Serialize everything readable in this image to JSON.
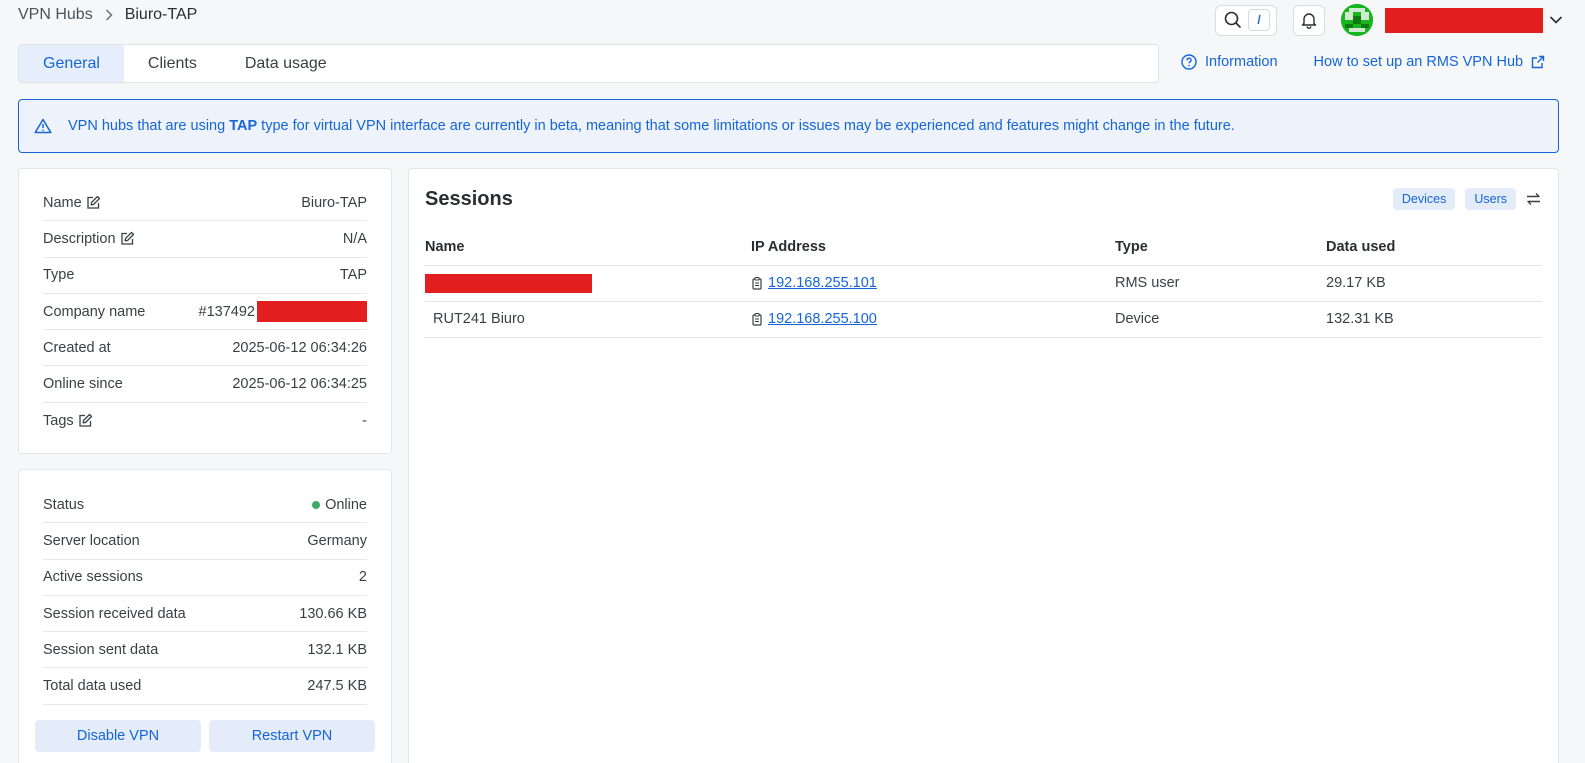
{
  "breadcrumb": {
    "parent": "VPN Hubs",
    "current": "Biuro-TAP"
  },
  "topbar": {
    "search_shortcut": "/"
  },
  "tabs": [
    {
      "label": "General",
      "active": true
    },
    {
      "label": "Clients",
      "active": false
    },
    {
      "label": "Data usage",
      "active": false
    }
  ],
  "links": {
    "information": "Information",
    "howto": "How to set up an RMS VPN Hub"
  },
  "alert": {
    "pre": "VPN hubs that are using ",
    "bold": "TAP",
    "post": " type for virtual VPN interface are currently in beta, meaning that some limitations or issues may be experienced and features might change in the future."
  },
  "info": {
    "name_label": "Name",
    "name_value": "Biuro-TAP",
    "description_label": "Description",
    "description_value": "N/A",
    "type_label": "Type",
    "type_value": "TAP",
    "company_label": "Company name",
    "company_value": "#137492",
    "created_label": "Created at",
    "created_value": "2025-06-12 06:34:26",
    "online_since_label": "Online since",
    "online_since_value": "2025-06-12 06:34:25",
    "tags_label": "Tags",
    "tags_value": "-"
  },
  "status": {
    "status_label": "Status",
    "status_value": "Online",
    "location_label": "Server location",
    "location_value": "Germany",
    "active_label": "Active sessions",
    "active_value": "2",
    "received_label": "Session received data",
    "received_value": "130.66 KB",
    "sent_label": "Session sent data",
    "sent_value": "132.1 KB",
    "total_label": "Total data used",
    "total_value": "247.5 KB",
    "disable_button": "Disable VPN",
    "restart_button": "Restart VPN"
  },
  "sessions": {
    "title": "Sessions",
    "filter_devices": "Devices",
    "filter_users": "Users",
    "columns": [
      "Name",
      "IP Address",
      "Type",
      "Data used"
    ],
    "rows": [
      {
        "name": "",
        "ip": "192.168.255.101",
        "type": "RMS user",
        "data": "29.17 KB"
      },
      {
        "name": "RUT241 Biuro",
        "ip": "192.168.255.100",
        "type": "Device",
        "data": "132.31 KB"
      }
    ]
  },
  "colors": {
    "accent": "#1565d8",
    "redaction": "#e31e1e",
    "online": "#3daa62",
    "avatar": "#18b51d"
  }
}
